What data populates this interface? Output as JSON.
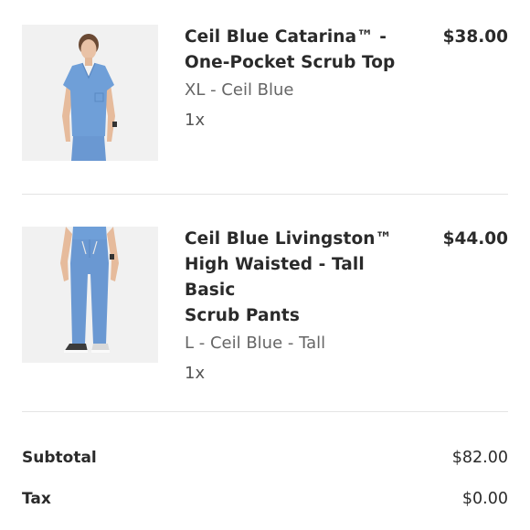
{
  "cart": {
    "items": [
      {
        "name_line1": "Ceil Blue Catarina™ -",
        "name_line2": "One-Pocket Scrub Top",
        "name_line3": "",
        "variant": "XL - Ceil Blue",
        "quantity": "1x",
        "price": "$38.00",
        "image_icon": "scrub-top-photo"
      },
      {
        "name_line1": "Ceil Blue Livingston™",
        "name_line2": "High Waisted - Tall Basic",
        "name_line3": "Scrub Pants",
        "variant": "L - Ceil Blue - Tall",
        "quantity": "1x",
        "price": "$44.00",
        "image_icon": "scrub-pants-photo"
      }
    ]
  },
  "summary": {
    "subtotal_label": "Subtotal",
    "subtotal_value": "$82.00",
    "tax_label": "Tax",
    "tax_value": "$0.00"
  },
  "colors": {
    "ceil_blue": "#6f9fd8",
    "thumb_bg": "#f1f1f1",
    "divider": "#e4e4e4"
  }
}
